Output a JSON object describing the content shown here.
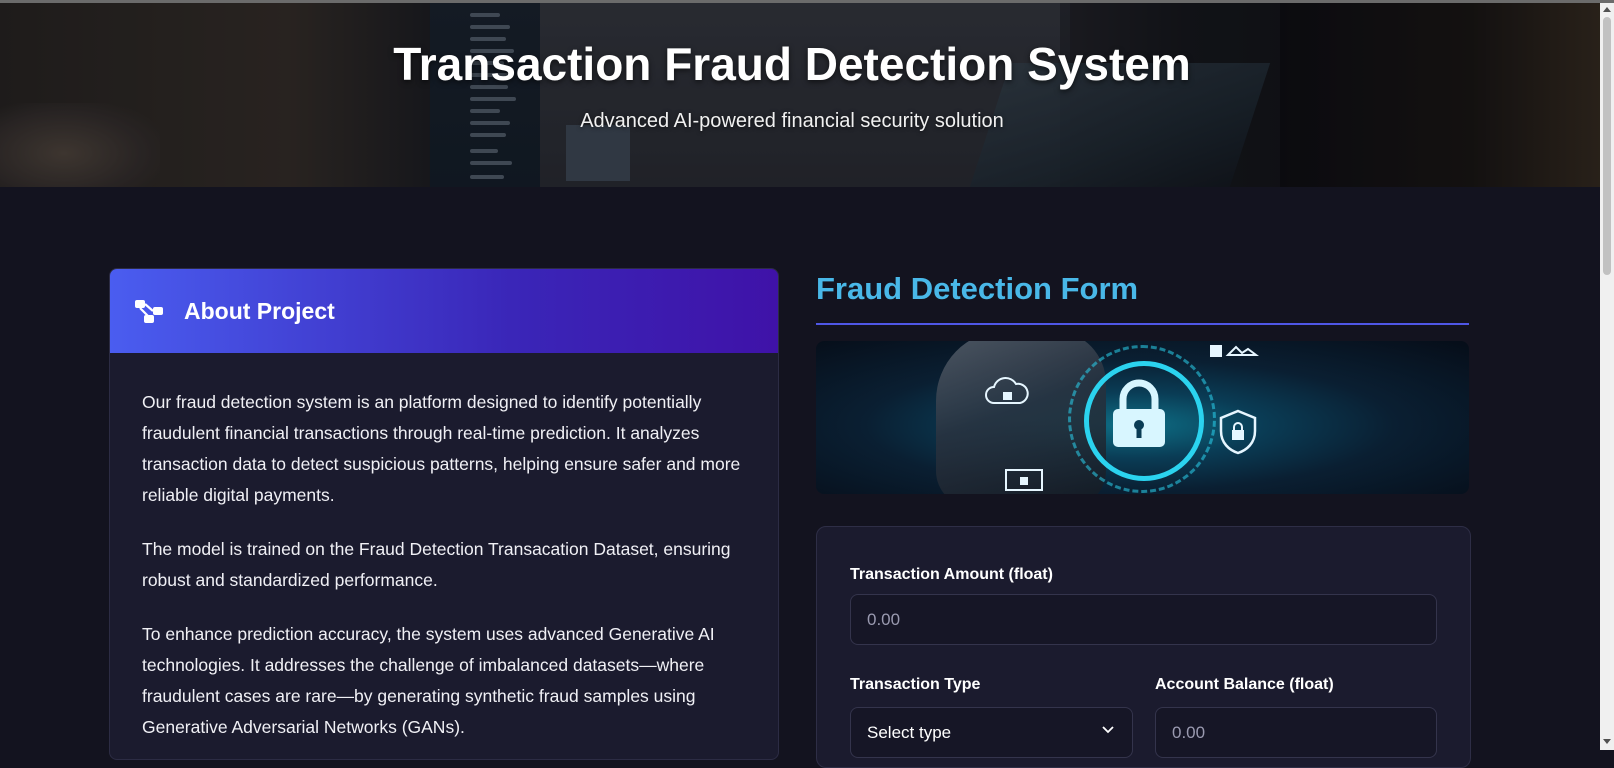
{
  "hero": {
    "title": "Transaction Fraud Detection System",
    "subtitle": "Advanced AI-powered financial security solution"
  },
  "about": {
    "title": "About Project",
    "icon": "sitemap-icon",
    "paragraphs": [
      "Our fraud detection system is an platform designed to identify potentially fraudulent financial transactions through real-time prediction. It analyzes transaction data to detect suspicious patterns, helping ensure safer and more reliable digital payments.",
      "The model is trained on the Fraud Detection Transacation Dataset, ensuring robust and standardized performance.",
      "To enhance prediction accuracy, the system uses advanced Generative AI technologies. It addresses the challenge of imbalanced datasets—where fraudulent cases are rare—by generating synthetic fraud samples using Generative Adversarial Networks (GANs)."
    ]
  },
  "form": {
    "title": "Fraud Detection Form",
    "amount": {
      "label": "Transaction Amount (float)",
      "placeholder": "0.00"
    },
    "type": {
      "label": "Transaction Type",
      "selected": "Select type"
    },
    "balance": {
      "label": "Account Balance (float)",
      "placeholder": "0.00"
    }
  },
  "colors": {
    "accent": "#49b8e8",
    "header_gradient_start": "#4a5df0",
    "header_gradient_end": "#3f12a8",
    "background": "#13131f",
    "card": "#1b1b2e"
  }
}
